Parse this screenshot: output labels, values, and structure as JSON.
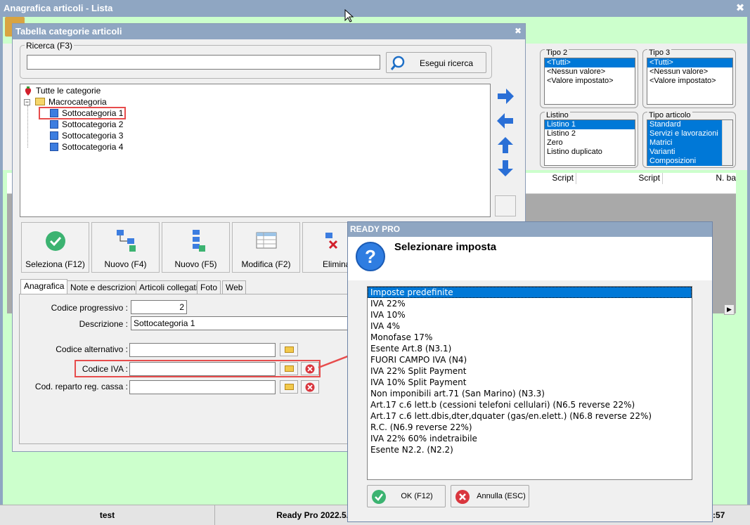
{
  "main": {
    "title": "Anagrafica articoli  - Lista",
    "close": "✖",
    "filters": {
      "tipo2": {
        "label": "Tipo 2",
        "items": [
          "<Tutti>",
          "<Nessun valore>",
          "<Valore impostato>"
        ],
        "selected": 0
      },
      "tipo3": {
        "label": "Tipo 3",
        "items": [
          "<Tutti>",
          "<Nessun valore>",
          "<Valore impostato>"
        ],
        "selected": 0
      },
      "listino": {
        "label": "Listino",
        "items": [
          "Listino 1",
          "Listino 2",
          "Zero",
          "Listino duplicato"
        ],
        "selected": 0
      },
      "tipo_articolo": {
        "label": "Tipo articolo",
        "items": [
          "Standard",
          "Servizi e lavorazioni",
          "Matrici",
          "Varianti",
          "Composizioni"
        ],
        "selected": [
          0,
          1,
          2,
          3,
          4
        ]
      }
    },
    "columns": [
      "Script",
      "Script",
      "N. ba"
    ],
    "status": {
      "user": "test",
      "version": "Ready Pro 2022.5.",
      "clock": ":57"
    }
  },
  "categorie": {
    "title": "Tabella categorie articoli",
    "close": "✖",
    "search": {
      "label": "Ricerca (F3)",
      "value": "",
      "button": "Esegui ricerca"
    },
    "tree": {
      "root": "Tutte le categorie",
      "macro": "Macrocategoria",
      "children": [
        "Sottocategoria 1",
        "Sottocategoria 2",
        "Sottocategoria 3",
        "Sottocategoria 4"
      ]
    },
    "buttons": {
      "seleziona": "Seleziona (F12)",
      "nuovo_f4": "Nuovo (F4)",
      "nuovo_f5": "Nuovo (F5)",
      "modifica": "Modifica (F2)",
      "elimina": "Elimina"
    },
    "tabs": [
      "Anagrafica",
      "Note e descrizioni",
      "Articoli collegati",
      "Foto",
      "Web"
    ],
    "form": {
      "codice_progressivo_label": "Codice progressivo :",
      "codice_progressivo": "2",
      "descrizione_label": "Descrizione :",
      "descrizione": "Sottocategoria 1",
      "codice_alternativo_label": "Codice alternativo :",
      "codice_alternativo": "",
      "codice_iva_label": "Codice IVA :",
      "codice_iva": "",
      "cod_reparto_label": "Cod. reparto reg. cassa :",
      "cod_reparto": ""
    }
  },
  "imposta": {
    "title": "READY PRO",
    "heading": "Selezionare imposta",
    "items": [
      "Imposte predefinite",
      "IVA 22%",
      "IVA 10%",
      "IVA 4%",
      "Monofase 17%",
      "Esente Art.8 (N3.1)",
      "FUORI CAMPO IVA (N4)",
      "IVA 22% Split Payment",
      "IVA 10% Split Payment",
      "Non imponibili art.71 (San Marino) (N3.3)",
      "Art.17  c.6 lett.b (cessioni telefoni cellulari) (N6.5 reverse 22%)",
      "Art.17 c.6 lett.dbis,dter,dquater (gas/en.elett.) (N6.8 reverse 22%)",
      "R.C. (N6.9 reverse 22%)",
      "IVA 22% 60% indetraibile",
      "Esente N2.2. (N2.2)"
    ],
    "selected": 0,
    "ok": "OK (F12)",
    "annulla": "Annulla (ESC)"
  },
  "colors": {
    "accent": "#0078d7",
    "highlight": "#e74c4c",
    "title_bar": "#8fa6c2",
    "background_green": "#ccffcc"
  }
}
